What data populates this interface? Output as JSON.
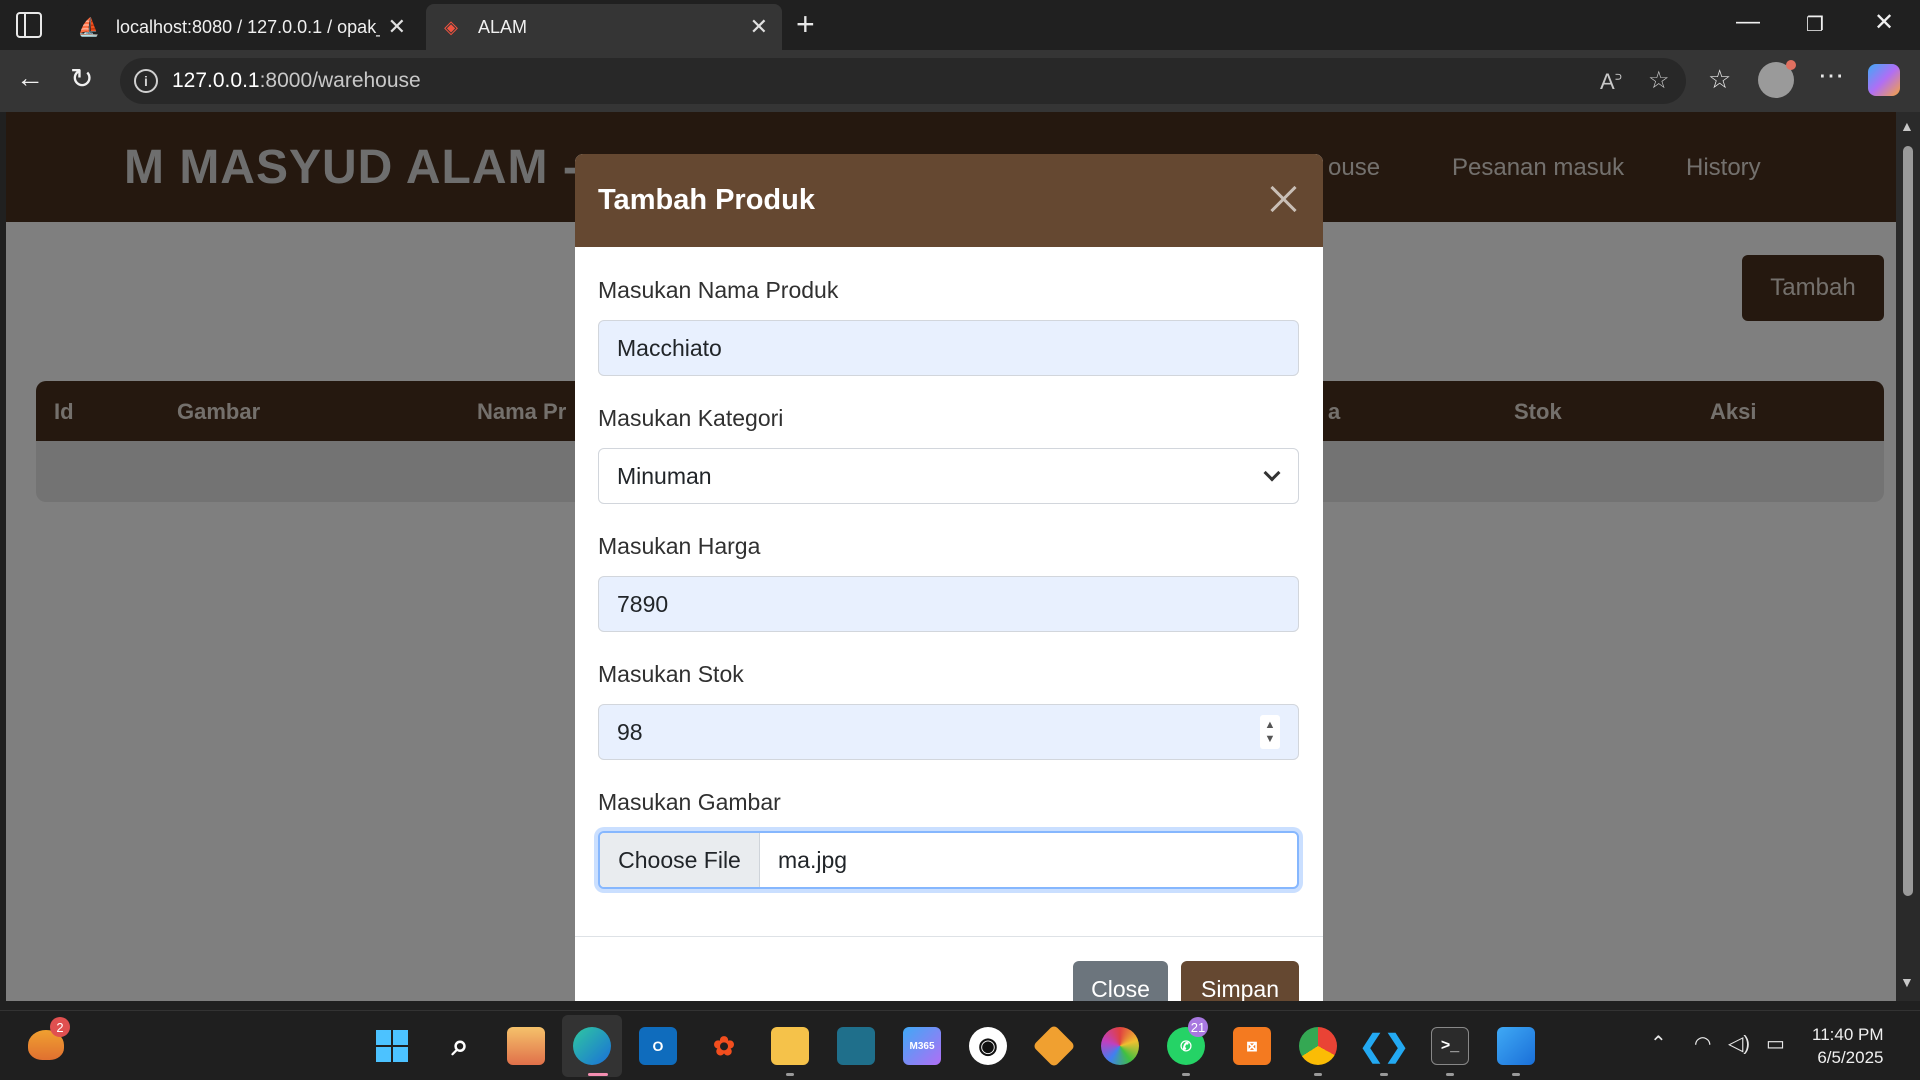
{
  "browser": {
    "tabs": [
      {
        "title": "localhost:8080 / 127.0.0.1 / opak_l",
        "icon": "phpmyadmin-icon"
      },
      {
        "title": "ALAM",
        "icon": "laravel-icon"
      }
    ],
    "url_host": "127.0.0.1",
    "url_path": ":8000/warehouse"
  },
  "site": {
    "brand": "M MASYUD ALAM - ",
    "nav": {
      "warehouse_partial": "ouse",
      "orders": "Pesanan masuk",
      "history": "History"
    },
    "add_button": "Tambah",
    "table_headers": [
      "Id",
      "Gambar",
      "Nama Pr",
      "a",
      "Stok",
      "Aksi"
    ]
  },
  "modal": {
    "title": "Tambah Produk",
    "fields": {
      "name_label": "Masukan Nama Produk",
      "name_value": "Macchiato",
      "category_label": "Masukan Kategori",
      "category_value": "Minuman",
      "price_label": "Masukan Harga",
      "price_value": "7890",
      "stock_label": "Masukan Stok",
      "stock_value": "98",
      "image_label": "Masukan Gambar",
      "file_button": "Choose File",
      "file_name": "ma.jpg"
    },
    "close_button": "Close",
    "save_button": "Simpan"
  },
  "taskbar": {
    "weather_badge": "2",
    "whatsapp_badge": "21",
    "m365_label": "M365",
    "time": "11:40 PM",
    "date": "6/5/2025"
  },
  "colors": {
    "navbar": "#4a311e",
    "modal_header": "#654831",
    "save_button": "#654831",
    "close_button": "#6c757d"
  }
}
